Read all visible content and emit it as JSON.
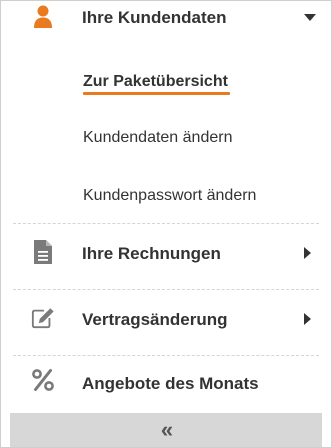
{
  "menu": {
    "customer": {
      "icon": "user-icon",
      "label": "Ihre Kundendaten",
      "submenu": [
        {
          "label": "Zur Paketübersicht",
          "active": true
        },
        {
          "label": "Kundendaten ändern",
          "active": false
        },
        {
          "label": "Kundenpasswort ändern",
          "active": false
        }
      ]
    },
    "invoices": {
      "icon": "document-icon",
      "label": "Ihre Rechnungen"
    },
    "contract": {
      "icon": "edit-icon",
      "label": "Vertragsänderung"
    },
    "offers": {
      "icon": "percent-icon",
      "label": "Angebote des Monats"
    }
  },
  "collapse": {
    "icon": "double-chevron-left-icon",
    "glyph": "«"
  },
  "colors": {
    "accent": "#ea7a1f",
    "icon_gray": "#7a7a7a",
    "text": "#333333",
    "collapse_bg": "#d7d7d7"
  }
}
